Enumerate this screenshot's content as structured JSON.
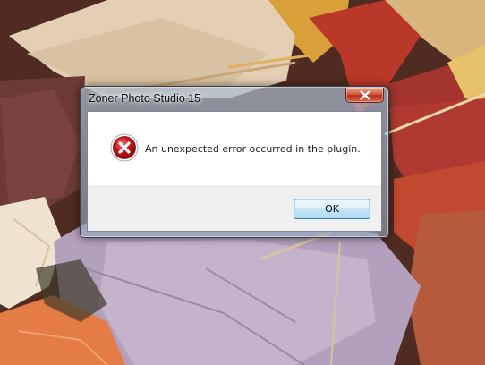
{
  "desktop": {
    "wallpaper": "autumn leaves"
  },
  "dialog": {
    "title": "Zoner Photo Studio 15",
    "close_icon": "close-icon",
    "status_icon": "error-icon",
    "message": "An unexpected error occurred in the plugin.",
    "ok_label": "OK"
  },
  "colors": {
    "error_red": "#c3141a",
    "close_button_red": "#c83c24",
    "ok_border": "#3c7fb1"
  }
}
